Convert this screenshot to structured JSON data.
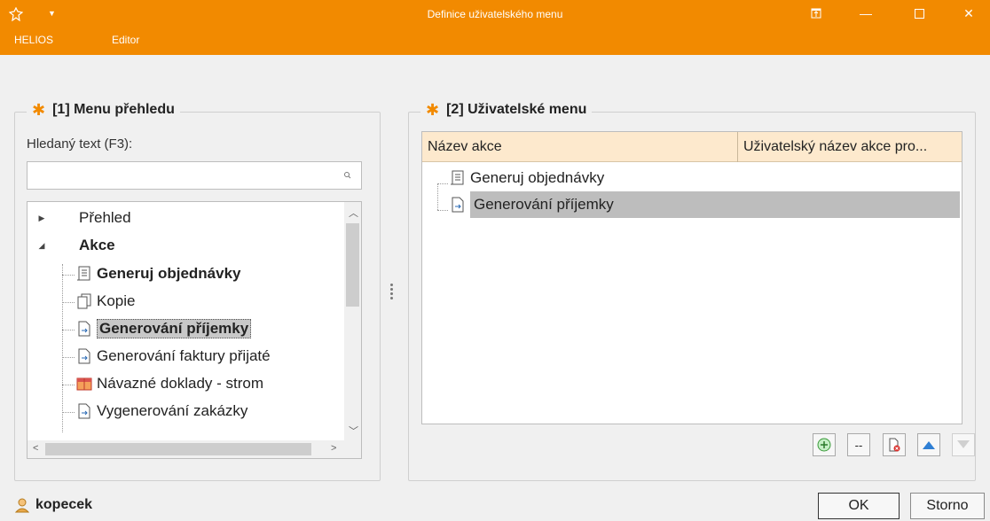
{
  "window": {
    "title": "Definice uživatelského menu",
    "menu": [
      "HELIOS",
      "Editor"
    ],
    "accent": "#f28a00"
  },
  "left_panel": {
    "title": "[1] Menu přehledu",
    "search_label": "Hledaný text (F3):",
    "search_value": "",
    "tree": [
      {
        "label": "Přehled",
        "icon": "collapsed-arrow-icon"
      },
      {
        "label": "Akce",
        "icon": "expanded-arrow-icon"
      },
      {
        "label": "Generuj objednávky",
        "icon": "list-document-icon"
      },
      {
        "label": "Kopie",
        "icon": "copy-icon"
      },
      {
        "label": "Generování příjemky",
        "icon": "generate-document-icon"
      },
      {
        "label": "Generování faktury přijaté",
        "icon": "generate-document-icon"
      },
      {
        "label": "Návazné doklady - strom",
        "icon": "linked-documents-icon"
      },
      {
        "label": "Vygenerování zakázky",
        "icon": "generate-document-icon"
      }
    ]
  },
  "right_panel": {
    "title": "[2] Uživatelské menu",
    "columns": [
      "Název akce",
      "Uživatelský název akce pro..."
    ],
    "rows": [
      {
        "label": "Generuj objednávky",
        "icon": "list-document-icon"
      },
      {
        "label": "Generování příjemky",
        "icon": "generate-document-icon"
      }
    ],
    "tool_buttons": [
      "add-icon",
      "separator-button",
      "delete-icon",
      "move-up-icon",
      "move-down-icon"
    ],
    "separator_label": "--"
  },
  "footer": {
    "user": "kopecek",
    "ok": "OK",
    "cancel": "Storno"
  }
}
